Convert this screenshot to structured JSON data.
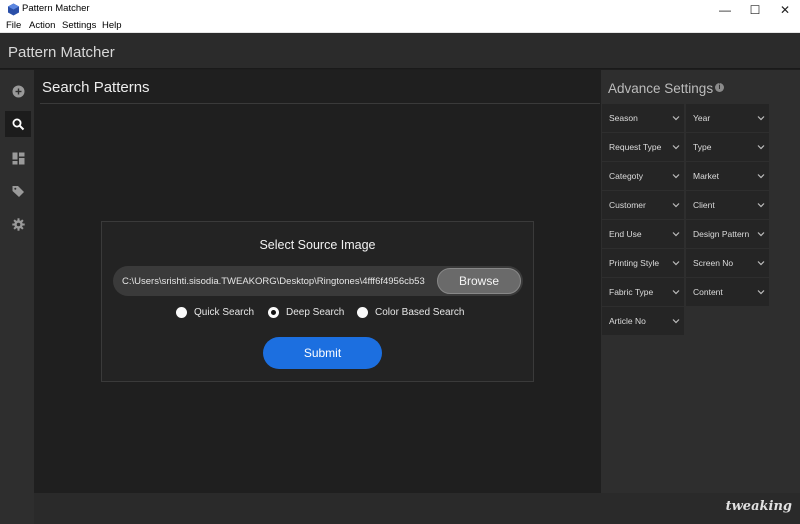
{
  "window": {
    "title": "Pattern Matcher",
    "minimize": "—",
    "maximize": "☐",
    "close": "✕"
  },
  "menu": [
    "File",
    "Action",
    "Settings",
    "Help"
  ],
  "app": {
    "title": "Pattern Matcher"
  },
  "nav": {
    "items": [
      {
        "icon": "add-circle-icon",
        "active": false
      },
      {
        "icon": "search-icon",
        "active": true
      },
      {
        "icon": "dashboard-icon",
        "active": false
      },
      {
        "icon": "tag-icon",
        "active": false
      },
      {
        "icon": "gear-icon",
        "active": false
      }
    ]
  },
  "main": {
    "heading": "Search Patterns",
    "card": {
      "title": "Select Source Image",
      "path": "C:\\Users\\srishti.sisodia.TWEAKORG\\Desktop\\Ringtones\\4fff6f4956cb53",
      "browse": "Browse",
      "radios": [
        {
          "label": "Quick Search",
          "checked": false
        },
        {
          "label": "Deep Search",
          "checked": true
        },
        {
          "label": "Color Based Search",
          "checked": false
        }
      ],
      "submit": "Submit"
    }
  },
  "settings": {
    "title": "Advance Settings",
    "left": [
      "Season",
      "Request Type",
      "Categoty",
      "Customer",
      "End Use",
      "Printing Style",
      "Fabric Type",
      "Article No"
    ],
    "right": [
      "Year",
      "Type",
      "Market",
      "Client",
      "Design Pattern",
      "Screen No",
      "Content"
    ]
  },
  "footer": {
    "watermark": "tweaking"
  },
  "colors": {
    "accent": "#1c6fe0",
    "background": "#1f1f1f",
    "panel": "#2e2e2e"
  }
}
